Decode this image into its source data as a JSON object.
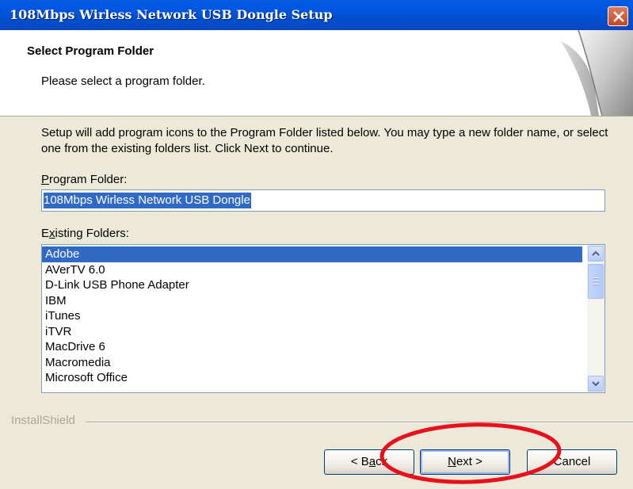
{
  "window": {
    "title": "108Mbps Wirless Network USB Dongle Setup"
  },
  "header": {
    "title": "Select Program Folder",
    "subtitle": "Please select a program folder."
  },
  "main": {
    "description": "Setup will add program icons to the Program Folder listed below.  You may type a new folder name, or select one from the existing folders list.  Click Next to continue.",
    "program_folder_label_key": "P",
    "program_folder_label_rest": "rogram Folder:",
    "program_folder_value": "108Mbps Wirless Network USB Dongle",
    "existing_folders_label_pre": "E",
    "existing_folders_label_key": "x",
    "existing_folders_label_rest": "isting Folders:",
    "existing_folders": [
      "Adobe",
      "AVerTV 6.0",
      "D-Link USB Phone Adapter",
      "IBM",
      "iTunes",
      "iTVR",
      "MacDrive 6",
      "Macromedia",
      "Microsoft Office"
    ],
    "selected_folder": "Adobe"
  },
  "footer": {
    "brand": "InstallShield",
    "back_pre": "< B",
    "back_key": "a",
    "back_rest": "ck",
    "next_key": "N",
    "next_rest": "ext >",
    "cancel": "Cancel"
  },
  "colors": {
    "title_bar": "#0054e3",
    "selection": "#316ac5",
    "annotation": "#e8101a"
  }
}
